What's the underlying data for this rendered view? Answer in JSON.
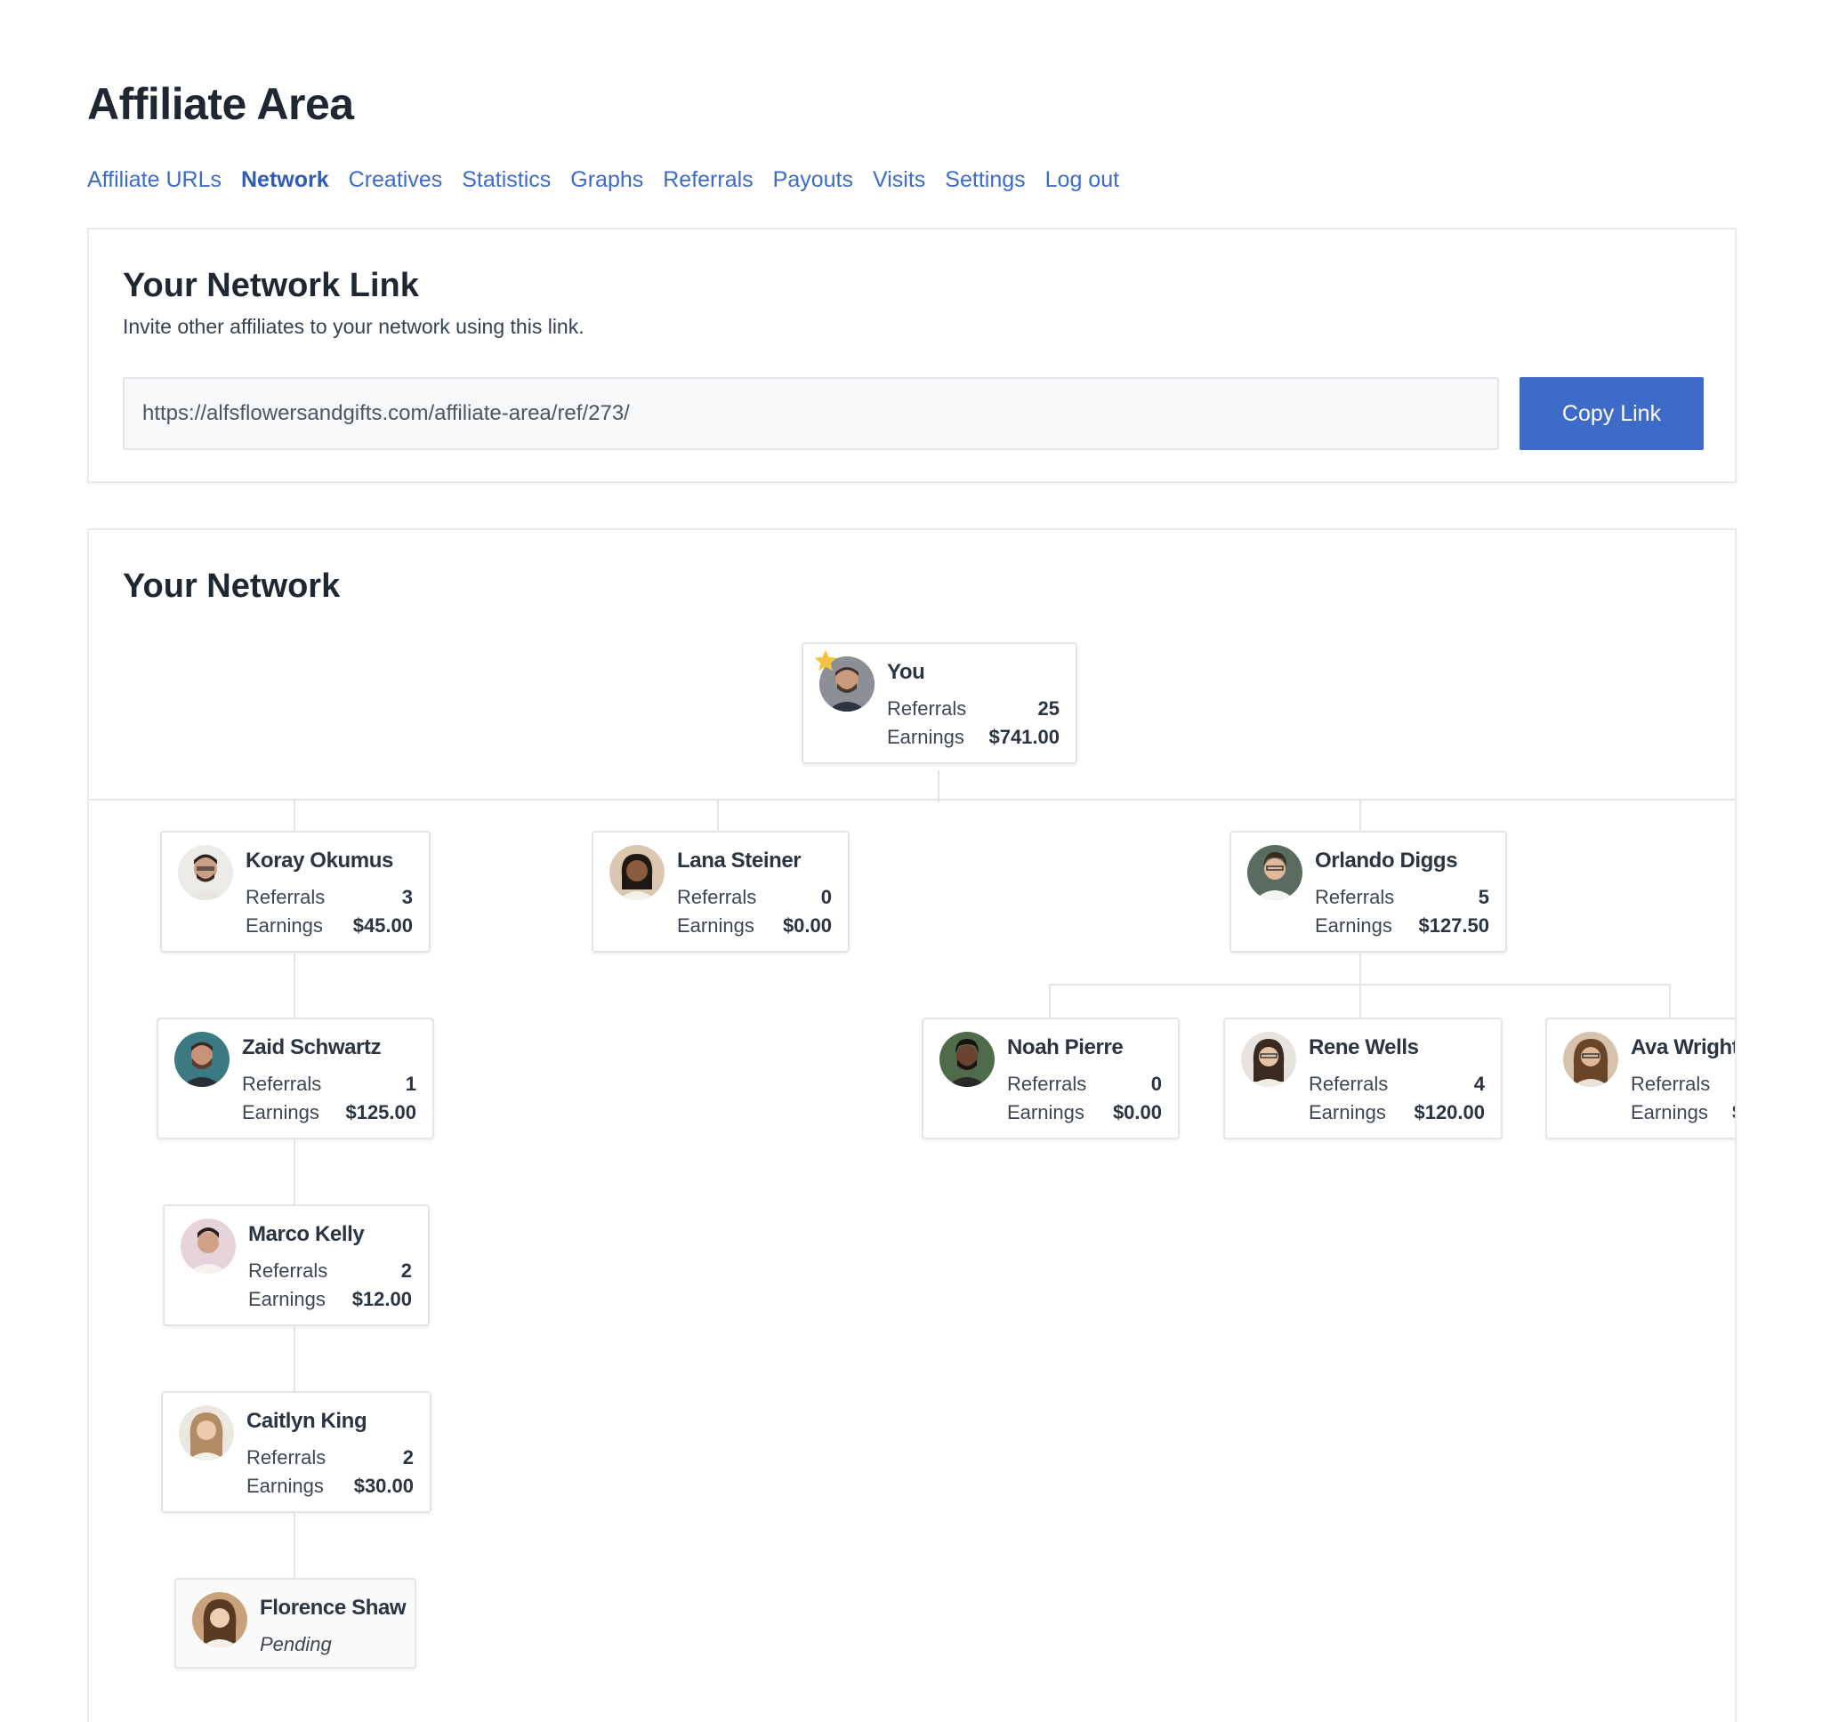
{
  "page_title": "Affiliate Area",
  "nav": [
    {
      "label": "Affiliate URLs",
      "active": false
    },
    {
      "label": "Network",
      "active": true
    },
    {
      "label": "Creatives",
      "active": false
    },
    {
      "label": "Statistics",
      "active": false
    },
    {
      "label": "Graphs",
      "active": false
    },
    {
      "label": "Referrals",
      "active": false
    },
    {
      "label": "Payouts",
      "active": false
    },
    {
      "label": "Visits",
      "active": false
    },
    {
      "label": "Settings",
      "active": false
    },
    {
      "label": "Log out",
      "active": false
    }
  ],
  "network_link": {
    "title": "Your Network Link",
    "description": "Invite other affiliates to your network using this link.",
    "url": "https://alfsflowersandgifts.com/affiliate-area/ref/273/",
    "copy_label": "Copy Link"
  },
  "network": {
    "title": "Your Network",
    "referrals_label": "Referrals",
    "earnings_label": "Earnings",
    "nodes": {
      "you": {
        "name": "You",
        "referrals": "25",
        "earnings": "$741.00"
      },
      "koray": {
        "name": "Koray Okumus",
        "referrals": "3",
        "earnings": "$45.00"
      },
      "lana": {
        "name": "Lana Steiner",
        "referrals": "0",
        "earnings": "$0.00"
      },
      "orlando": {
        "name": "Orlando Diggs",
        "referrals": "5",
        "earnings": "$127.50"
      },
      "zaid": {
        "name": "Zaid Schwartz",
        "referrals": "1",
        "earnings": "$125.00"
      },
      "noah": {
        "name": "Noah Pierre",
        "referrals": "0",
        "earnings": "$0.00"
      },
      "rene": {
        "name": "Rene Wells",
        "referrals": "4",
        "earnings": "$120.00"
      },
      "ava": {
        "name": "Ava Wright",
        "referrals": "",
        "earnings": "$"
      },
      "marco": {
        "name": "Marco Kelly",
        "referrals": "2",
        "earnings": "$12.00"
      },
      "caitlyn": {
        "name": "Caitlyn King",
        "referrals": "2",
        "earnings": "$30.00"
      },
      "florence": {
        "name": "Florence Shaw",
        "status": "Pending"
      }
    }
  },
  "colors": {
    "accent": "#3f6bc8",
    "link": "#3d6bc6",
    "star": "#f5c542"
  }
}
